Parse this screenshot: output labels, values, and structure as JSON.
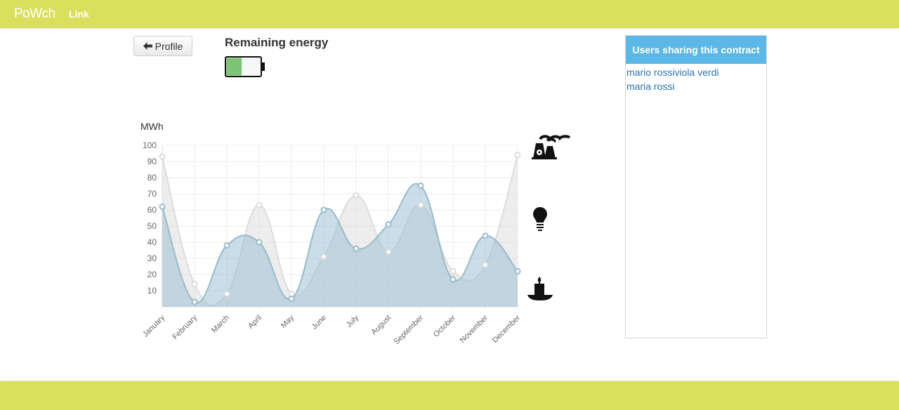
{
  "nav": {
    "brand": "PoWch",
    "link": "Link"
  },
  "profile_button": {
    "label": "Profile",
    "icon": "arrow-left-icon"
  },
  "energy": {
    "title": "Remaining energy",
    "battery_level": 0.45,
    "battery_color": "#7cc576"
  },
  "sidebar": {
    "header": "Users sharing this contract",
    "users": [
      "mario rossiviola verdi",
      "maria rossi"
    ],
    "header_color": "#5bb8e6",
    "link_color": "#2a72b8"
  },
  "legend_icons": [
    "nuclear-plant-icon",
    "light-bulb-icon",
    "candle-icon"
  ],
  "chart_data": {
    "type": "area",
    "ylabel": "MWh",
    "ylim": [
      0,
      100
    ],
    "yticks": [
      10,
      20,
      30,
      40,
      50,
      60,
      70,
      80,
      90,
      100
    ],
    "categories": [
      "January",
      "February",
      "March",
      "April",
      "May",
      "June",
      "July",
      "August",
      "September",
      "October",
      "November",
      "December"
    ],
    "grid": true,
    "series": [
      {
        "values": [
          93,
          14,
          8,
          63,
          8,
          31,
          69,
          34,
          63,
          22,
          26,
          94
        ],
        "color": "#dcdcdc"
      },
      {
        "values": [
          62,
          3,
          38,
          40,
          5,
          60,
          36,
          51,
          75,
          17,
          44,
          22
        ],
        "color": "#97bbcd"
      }
    ]
  }
}
